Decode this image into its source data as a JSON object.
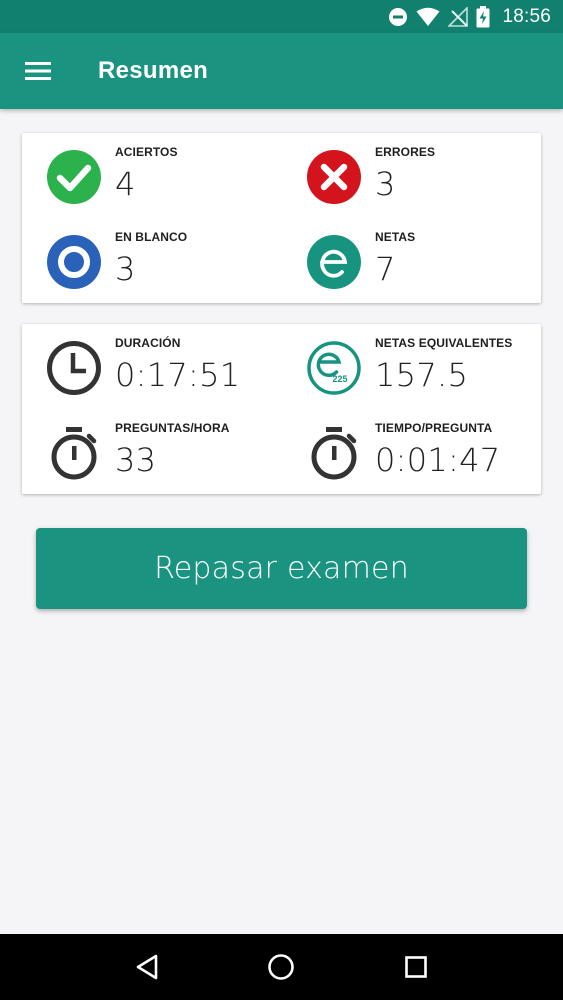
{
  "status_bar": {
    "time": "18:56",
    "icons": [
      "do-not-disturb-icon",
      "wifi-icon",
      "no-signal-icon",
      "battery-charging-icon"
    ]
  },
  "app_bar": {
    "title": "Resumen",
    "menu_icon": "hamburger-menu-icon"
  },
  "summary_card": {
    "aciertos": {
      "label": "ACIERTOS",
      "value": "4",
      "icon": "check-circle-icon",
      "color": "#2bb24c"
    },
    "errores": {
      "label": "ERRORES",
      "value": "3",
      "icon": "x-circle-icon",
      "color": "#d4141c"
    },
    "en_blanco": {
      "label": "EN BLANCO",
      "value": "3",
      "icon": "blank-ring-icon",
      "color": "#2962b8"
    },
    "netas": {
      "label": "NETAS",
      "value": "7",
      "icon": "e-circle-icon",
      "color": "#179480"
    }
  },
  "time_card": {
    "duracion": {
      "label": "DURACIÓN",
      "value": "0:17:51",
      "icon": "clock-icon"
    },
    "netas_equivalentes": {
      "label": "NETAS EQUIVALENTES",
      "value": "157.5",
      "icon": "e-225-icon",
      "badge": "225"
    },
    "preguntas_hora": {
      "label": "PREGUNTAS/HORA",
      "value": "33",
      "icon": "stopwatch-icon"
    },
    "tiempo_pregunta": {
      "label": "TIEMPO/PREGUNTA",
      "value": "0:01:47",
      "icon": "stopwatch-icon"
    }
  },
  "review_button": {
    "label": "Repasar examen"
  },
  "nav_bar": {
    "icons": [
      "back-icon",
      "home-icon",
      "recents-icon"
    ]
  },
  "colors": {
    "primary": "#1a9481",
    "primary_dark": "#11806f"
  }
}
